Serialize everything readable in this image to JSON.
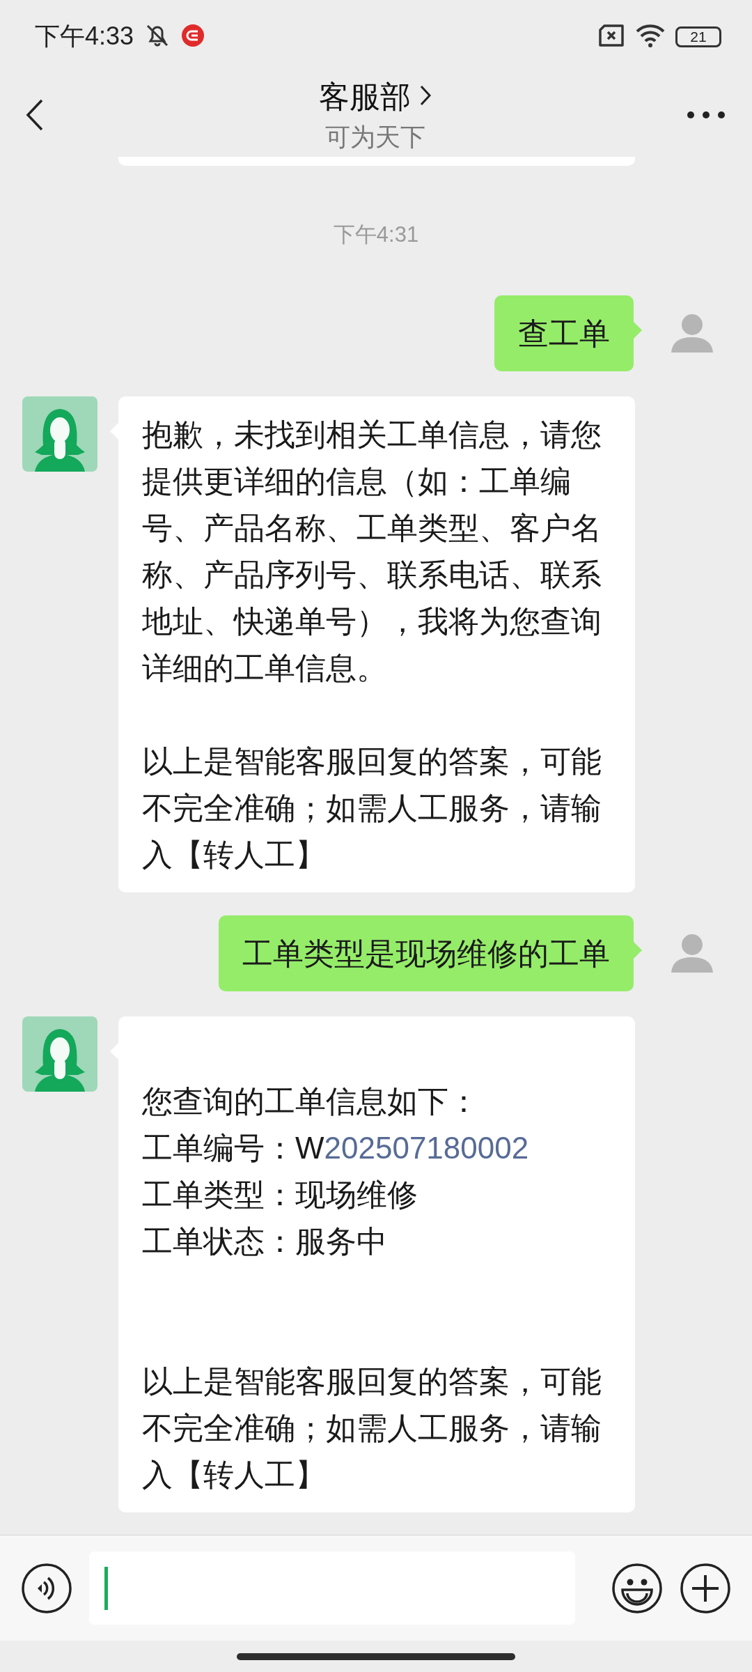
{
  "status_bar": {
    "time": "下午4:33",
    "battery": "21"
  },
  "header": {
    "title": "客服部",
    "subtitle": "可为天下"
  },
  "messages": [
    {
      "kind": "timestamp",
      "text": "下午4:31"
    },
    {
      "kind": "outgoing",
      "lines": [
        {
          "kind": "body",
          "segments": [
            {
              "kind": "plain",
              "text": "查工单"
            }
          ]
        }
      ]
    },
    {
      "kind": "incoming",
      "lines": [
        {
          "kind": "body",
          "segments": [
            {
              "kind": "plain",
              "text": "抱歉，未找到相关工单信息，请您提供更详细的信息（如：工单编号、产品名称、工单类型、客户名称、产品序列号、联系电话、联系地址、快递单号），我将为您查询详细的工单信息。"
            }
          ]
        },
        {
          "kind": "disclaimer",
          "segments": [
            {
              "kind": "plain",
              "text": "以上是智能客服回复的答案，可能不完全准确；如需人工服务，请输入【转人工】"
            }
          ]
        }
      ]
    },
    {
      "kind": "outgoing",
      "lines": [
        {
          "kind": "body",
          "segments": [
            {
              "kind": "plain",
              "text": "工单类型是现场维修的工单"
            }
          ]
        }
      ]
    },
    {
      "kind": "incoming",
      "lines": [
        {
          "kind": "intro",
          "segments": [
            {
              "kind": "plain",
              "text": "您查询的工单信息如下："
            }
          ]
        },
        {
          "kind": "field",
          "segments": [
            {
              "kind": "plain",
              "text": "工单编号：W"
            },
            {
              "kind": "link",
              "text": "202507180002"
            }
          ]
        },
        {
          "kind": "field",
          "segments": [
            {
              "kind": "plain",
              "text": "工单类型：现场维修"
            }
          ]
        },
        {
          "kind": "field",
          "segments": [
            {
              "kind": "plain",
              "text": "工单状态：服务中"
            }
          ]
        },
        {
          "kind": "disclaimer",
          "segments": [
            {
              "kind": "plain",
              "text": "以上是智能客服回复的答案，可能不完全准确；如需人工服务，请输入【转人工】"
            }
          ]
        }
      ]
    }
  ]
}
